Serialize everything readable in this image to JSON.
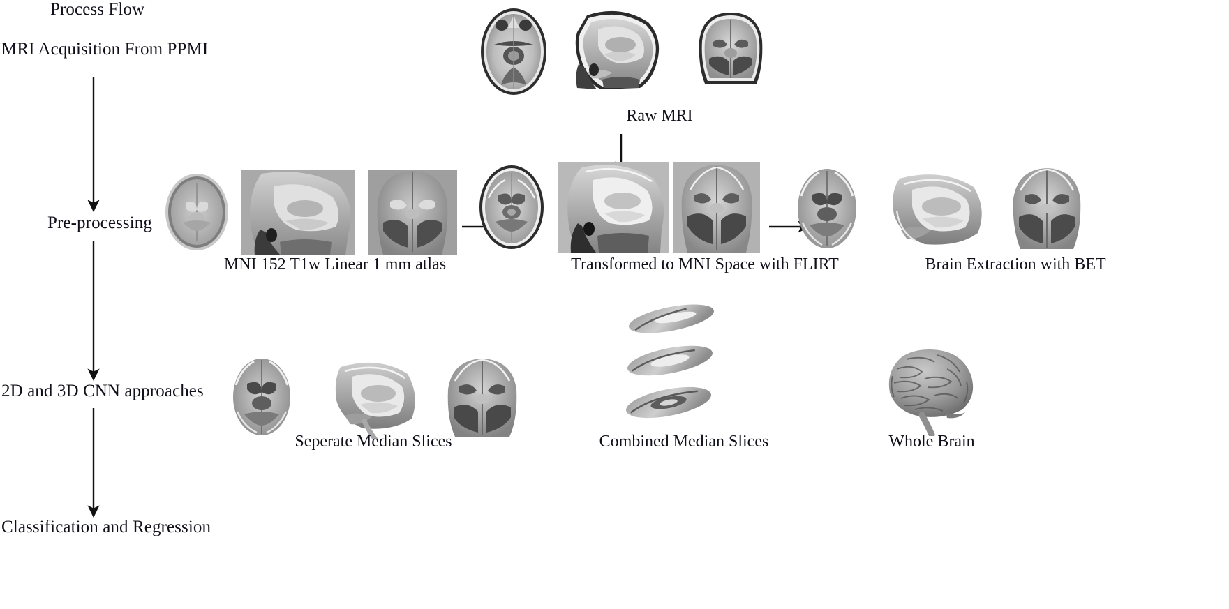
{
  "diagram": {
    "title": "Process Flow",
    "flow_stages": [
      {
        "label": "MRI Acquisition From PPMI"
      },
      {
        "label": "Pre-processing"
      },
      {
        "label": "2D and 3D CNN approaches"
      },
      {
        "label": "Classification and Regression"
      }
    ],
    "rows": {
      "raw": {
        "caption": "Raw MRI",
        "views": [
          "axial",
          "sagittal",
          "coronal"
        ]
      },
      "preprocessing": {
        "groups": [
          {
            "caption": "MNI 152 T1w Linear 1 mm atlas",
            "views": [
              "axial",
              "sagittal",
              "coronal"
            ]
          },
          {
            "caption": "Transformed to MNI Space with FLIRT",
            "views": [
              "axial",
              "sagittal",
              "coronal"
            ]
          },
          {
            "caption": "Brain Extraction with BET",
            "views": [
              "axial",
              "sagittal",
              "coronal"
            ]
          }
        ]
      },
      "cnn": {
        "groups": [
          {
            "caption": "Seperate Median Slices",
            "views": [
              "axial",
              "sagittal",
              "coronal"
            ]
          },
          {
            "caption": "Combined Median Slices",
            "views": [
              "sagittal-tilt",
              "axial-tilt",
              "axial-tilt"
            ]
          },
          {
            "caption": "Whole Brain",
            "views": [
              "brain-3d"
            ]
          }
        ]
      }
    },
    "colors": {
      "ink": "#10101a",
      "arrow": "#111111",
      "background": "#ffffff"
    }
  }
}
